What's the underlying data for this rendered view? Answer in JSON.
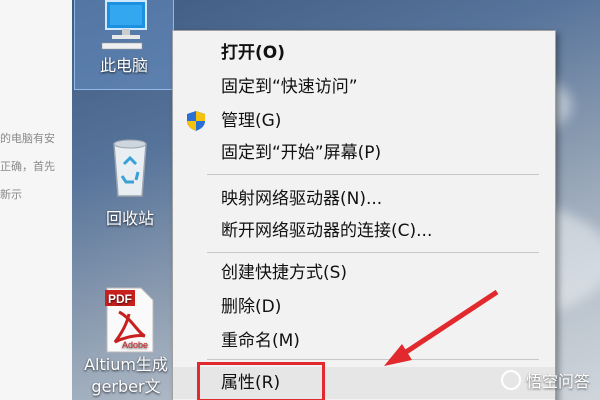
{
  "page_fragments": [
    "的电脑有安",
    "正确，首先",
    "新示"
  ],
  "desktop_icons": [
    {
      "label": "此电脑"
    },
    {
      "label": "回收站"
    },
    {
      "label_line1": "Altium生成",
      "label_line2": "gerber文",
      "pdf_badge": "PDF",
      "adobe_text": "Adobe"
    }
  ],
  "context_menu": {
    "items": [
      {
        "label": "打开(O)"
      },
      {
        "label": "固定到“快速访问”"
      },
      {
        "label": "管理(G)"
      },
      {
        "label": "固定到“开始”屏幕(P)"
      },
      {
        "label": "映射网络驱动器(N)..."
      },
      {
        "label": "断开网络驱动器的连接(C)..."
      },
      {
        "label": "创建快捷方式(S)"
      },
      {
        "label": "删除(D)"
      },
      {
        "label": "重命名(M)"
      },
      {
        "label": "属性(R)"
      }
    ]
  },
  "highlight_color": "#e2292d",
  "watermark": {
    "text": "悟空问答"
  }
}
